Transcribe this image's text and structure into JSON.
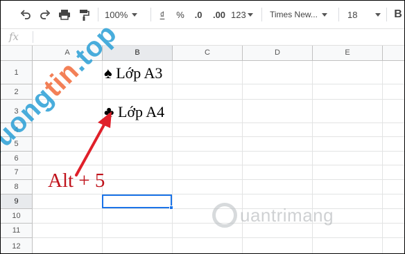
{
  "toolbar": {
    "zoom": "100%",
    "currency": "₫",
    "percent": "%",
    "decrease_decimal": ".0",
    "increase_decimal": ".00",
    "more_formats": "123",
    "font_family": "Times New...",
    "font_size": "18",
    "bold": "B"
  },
  "formula_bar": {
    "fx_label": "fx",
    "value": ""
  },
  "columns": [
    "A",
    "B",
    "C",
    "D",
    "E"
  ],
  "rows": [
    "1",
    "2",
    "3",
    "4",
    "5",
    "6",
    "7",
    "8",
    "9",
    "10",
    "11",
    "12"
  ],
  "selected": {
    "column": "B",
    "row": "9"
  },
  "cells": {
    "B1": "♠ Lớp A3",
    "B3": "♣ Lớp A4"
  },
  "annotation": {
    "text": "Alt + 5",
    "arrow_color": "#e0202a"
  },
  "watermarks": {
    "left_part1": "truong",
    "left_part2": "tin",
    "left_part3": ".top",
    "right": "uantrimang"
  },
  "colors": {
    "selection": "#1a73e8",
    "annotation": "#c0121b"
  }
}
